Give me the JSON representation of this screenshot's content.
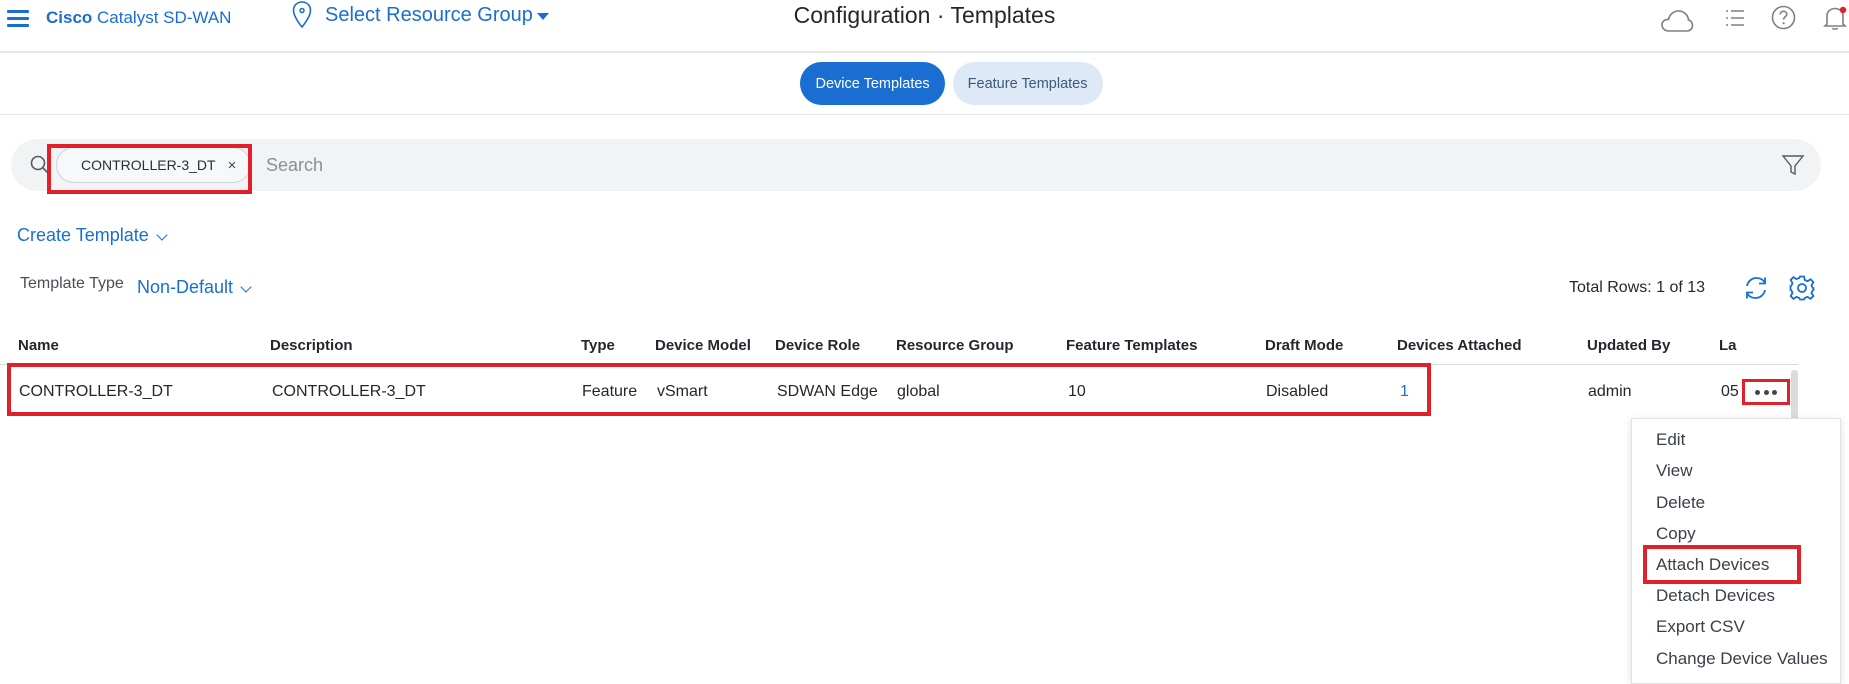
{
  "header": {
    "brand_bold": "Cisco",
    "brand_rest": " Catalyst SD-WAN",
    "resource_group_label": "Select Resource Group",
    "title_main": "Configuration",
    "title_separator": " · ",
    "title_section": "Templates"
  },
  "tabs": [
    {
      "label": "Device Templates",
      "active": true
    },
    {
      "label": "Feature Templates",
      "active": false
    }
  ],
  "search": {
    "chip_label": "CONTROLLER-3_DT",
    "chip_remove": "×",
    "placeholder": "Search"
  },
  "toolbar": {
    "create_template_label": "Create Template",
    "template_type_label": "Template Type",
    "template_type_value": "Non-Default",
    "total_rows": "Total Rows: 1 of 13"
  },
  "table": {
    "columns": [
      "Name",
      "Description",
      "Type",
      "Device Model",
      "Device Role",
      "Resource Group",
      "Feature Templates",
      "Draft Mode",
      "Devices Attached",
      "Updated By",
      "La"
    ],
    "rows": [
      {
        "name": "CONTROLLER-3_DT",
        "description": "CONTROLLER-3_DT",
        "type": "Feature",
        "device_model": "vSmart",
        "device_role": "SDWAN Edge",
        "resource_group": "global",
        "feature_templates": "10",
        "draft_mode": "Disabled",
        "devices_attached": "1",
        "updated_by": "admin",
        "last_updated_partial": "05"
      }
    ]
  },
  "context_menu": {
    "items": [
      "Edit",
      "View",
      "Delete",
      "Copy",
      "Attach Devices",
      "Detach Devices",
      "Export CSV",
      "Change Device Values"
    ],
    "highlighted": "Attach Devices"
  },
  "colors": {
    "accent": "#1a6ed2",
    "highlight": "#e0202b",
    "tab_inactive_bg": "#dde9f6",
    "search_bg": "#f2f3f5"
  },
  "icons": [
    "hamburger-menu-icon",
    "location-pin-icon",
    "cloud-icon",
    "task-list-icon",
    "help-icon",
    "bell-icon",
    "search-icon",
    "filter-icon",
    "refresh-icon",
    "gear-icon",
    "more-options-icon"
  ]
}
